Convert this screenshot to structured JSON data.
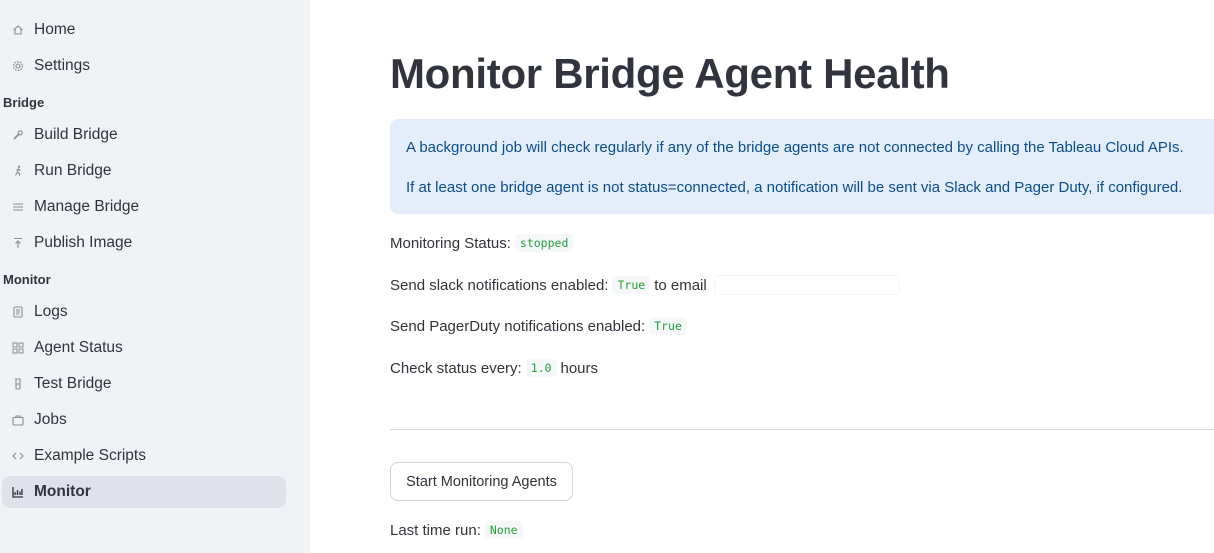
{
  "sidebar": {
    "top_items": [
      {
        "label": "Home",
        "icon": "home-icon"
      },
      {
        "label": "Settings",
        "icon": "gear-icon"
      }
    ],
    "sections": [
      {
        "label": "Bridge",
        "items": [
          {
            "label": "Build Bridge",
            "icon": "wrench-icon"
          },
          {
            "label": "Run Bridge",
            "icon": "runner-icon"
          },
          {
            "label": "Manage Bridge",
            "icon": "list-icon"
          },
          {
            "label": "Publish Image",
            "icon": "upload-icon"
          }
        ]
      },
      {
        "label": "Monitor",
        "items": [
          {
            "label": "Logs",
            "icon": "document-icon"
          },
          {
            "label": "Agent Status",
            "icon": "grid-icon"
          },
          {
            "label": "Test Bridge",
            "icon": "test-tube-icon"
          },
          {
            "label": "Jobs",
            "icon": "briefcase-icon"
          },
          {
            "label": "Example Scripts",
            "icon": "code-icon"
          },
          {
            "label": "Monitor",
            "icon": "monitor-chart-icon",
            "active": true
          }
        ]
      }
    ]
  },
  "main": {
    "title": "Monitor Bridge Agent Health",
    "info_lines": [
      "A background job will check regularly if any of the bridge agents are not connected by calling the Tableau Cloud APIs.",
      "If at least one bridge agent is not status=connected, a notification will be sent via Slack and Pager Duty, if configured."
    ],
    "monitoring_status": {
      "label": "Monitoring Status:",
      "value": "stopped"
    },
    "slack": {
      "label": "Send slack notifications enabled:",
      "value": "True",
      "to_email_label": "to email",
      "email_value": ""
    },
    "pagerduty": {
      "label": "Send PagerDuty notifications enabled:",
      "value": "True"
    },
    "check_status": {
      "label": "Check status every:",
      "value": "1.0",
      "unit": "hours"
    },
    "start_button_label": "Start Monitoring Agents",
    "last_run": {
      "label": "Last time run:",
      "value": "None"
    }
  },
  "colors": {
    "sidebar_bg": "#f0f2f6",
    "active_item_bg": "#dfe2ea",
    "info_bg": "#e4eefb",
    "info_text": "#0b4d8b",
    "code_text": "#21a03a",
    "text": "#31333f"
  }
}
